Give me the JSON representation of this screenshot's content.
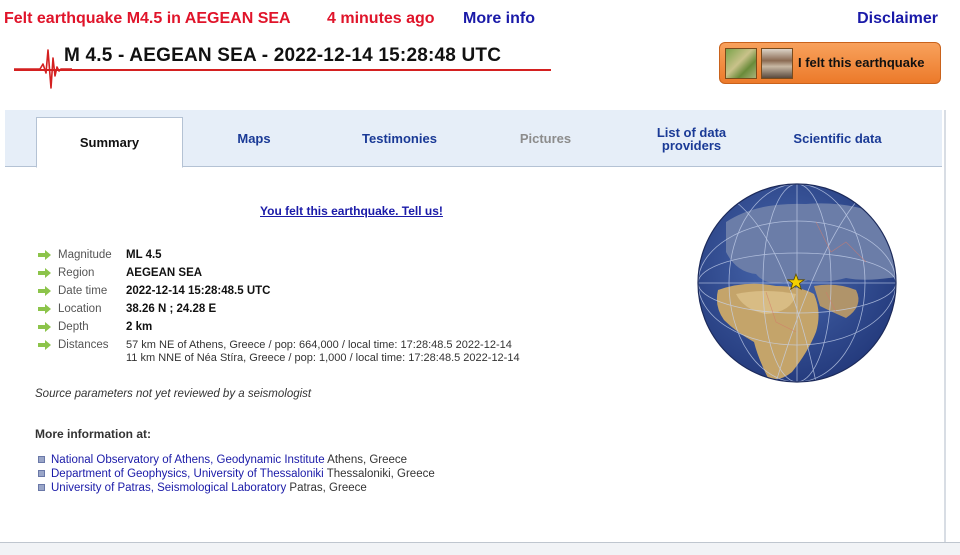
{
  "header": {
    "felt_text": "Felt earthquake M4.5 in AEGEAN SEA",
    "ago_text": "4 minutes ago",
    "more_info": "More info",
    "disclaimer": "Disclaimer"
  },
  "title": "M 4.5 - AEGEAN SEA - 2022-12-14 15:28:48 UTC",
  "felt_button": {
    "label": "I felt this earthquake"
  },
  "tabs": [
    {
      "label": "Summary",
      "state": "active"
    },
    {
      "label": "Maps",
      "state": "normal"
    },
    {
      "label": "Testimonies",
      "state": "normal"
    },
    {
      "label": "Pictures",
      "state": "disabled"
    },
    {
      "label": "List of data providers",
      "state": "normal"
    },
    {
      "label": "Scientific data",
      "state": "normal"
    }
  ],
  "tell_us": "You felt this earthquake. Tell us!",
  "params": [
    {
      "key": "Magnitude",
      "value": "ML 4.5"
    },
    {
      "key": "Region",
      "value": "AEGEAN SEA"
    },
    {
      "key": "Date time",
      "value": "2022-12-14 15:28:48.5 UTC"
    },
    {
      "key": "Location",
      "value": "38.26 N ; 24.28 E"
    },
    {
      "key": "Depth",
      "value": "2 km"
    }
  ],
  "distances": {
    "key": "Distances",
    "lines": [
      "57 km NE of Athens, Greece / pop: 664,000 / local time: 17:28:48.5 2022-12-14",
      "11 km NNE of Néa Stíra, Greece / pop: 1,000 / local time: 17:28:48.5 2022-12-14"
    ]
  },
  "source_note": "Source parameters not yet reviewed by a seismologist",
  "more_info_heading": "More information at:",
  "links": [
    {
      "name": "National Observatory of Athens, Geodynamic Institute",
      "place": "Athens, Greece"
    },
    {
      "name": "Department of Geophysics, University of Thessaloniki",
      "place": "Thessaloniki, Greece"
    },
    {
      "name": "University of Patras, Seismological Laboratory",
      "place": "Patras, Greece"
    }
  ],
  "colors": {
    "alert_red": "#e0142a",
    "link_blue": "#1a1aa8",
    "tab_blue": "#1a3a96",
    "button_orange": "#ec7a2a",
    "epicenter_star": "#f5d000"
  },
  "icons": {
    "param_bullet": "green-arrow-icon",
    "link_bullet": "square-bullet-icon",
    "seismogram": "seismogram-logo",
    "globe": "globe-map",
    "epicenter": "star-icon"
  }
}
